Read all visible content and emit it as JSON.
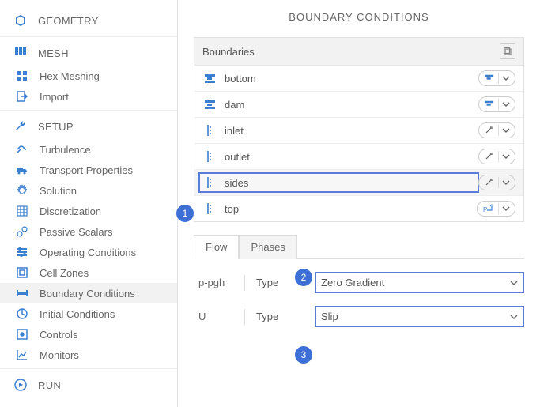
{
  "title": "BOUNDARY CONDITIONS",
  "sidebar": {
    "geometry": "GEOMETRY",
    "mesh": "MESH",
    "hex_meshing": "Hex Meshing",
    "import": "Import",
    "setup": "SETUP",
    "turbulence": "Turbulence",
    "transport": "Transport Properties",
    "solution": "Solution",
    "discretization": "Discretization",
    "passive": "Passive Scalars",
    "operating": "Operating Conditions",
    "cell": "Cell Zones",
    "boundary": "Boundary Conditions",
    "initial": "Initial Conditions",
    "controls": "Controls",
    "monitors": "Monitors",
    "run": "RUN"
  },
  "panel": {
    "header": "Boundaries"
  },
  "rows": {
    "r0": "bottom",
    "r1": "dam",
    "r2": "inlet",
    "r3": "outlet",
    "r4": "sides",
    "r5": "top"
  },
  "tabs": {
    "flow": "Flow",
    "phases": "Phases"
  },
  "form": {
    "f1_label": "p-pgh",
    "type_label": "Type",
    "f1_value": "Zero Gradient",
    "f2_label": "U",
    "f2_value": "Slip"
  },
  "badges": {
    "b1": "1",
    "b2": "2",
    "b3": "3"
  }
}
